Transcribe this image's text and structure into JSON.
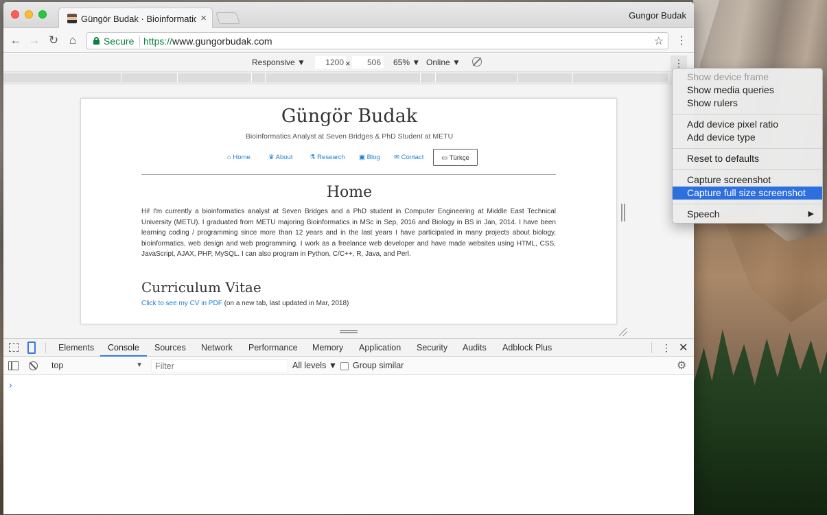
{
  "browser": {
    "tab_title": "Güngör Budak · Bioinformatics",
    "tab_close": "×",
    "profile_name": "Gungor Budak",
    "secure_label": "Secure",
    "url_scheme": "https://",
    "url_host": "www.gungorbudak.com",
    "back": "←",
    "forward": "→",
    "reload": "↻",
    "home": "⌂",
    "bookmark_star": "☆",
    "menu": "⋮"
  },
  "device_toolbar": {
    "device": "Responsive ▼",
    "width": "1200",
    "times": "×",
    "height": "506",
    "zoom": "65% ▼",
    "network": "Online ▼",
    "more": "⋮"
  },
  "site": {
    "title": "Güngör Budak",
    "subtitle": "Bioinformatics Analyst at Seven Bridges & PhD Student at METU",
    "nav": {
      "home": "Home",
      "about": "About",
      "research": "Research",
      "blog": "Blog",
      "contact": "Contact",
      "turkish": "Türkçe"
    },
    "nav_icons": {
      "home": "⌂",
      "about": "♛",
      "research": "⚗",
      "blog": "▣",
      "contact": "✉",
      "turkish": "▭"
    },
    "home_heading": "Home",
    "intro": "Hi! I'm currently a bioinformatics analyst at Seven Bridges and a PhD student in Computer Engineering at Middle East Technical University (METU). I graduated from METU majoring Bioinformatics in MSc in Sep, 2016 and Biology in BS in Jan, 2014. I have been learning coding / programming since more than 12 years and in the last years I have participated in many projects about biology, bioinformatics, web design and web programming. I work as a freelance web developer and have made websites using HTML, CSS, JavaScript, AJAX, PHP, MySQL. I can also program in Python, C/C++, R, Java, and Perl.",
    "cv_heading": "Curriculum Vitae",
    "cv_link": "Click to see my CV in PDF",
    "cv_note": " (on a new tab, last updated in Mar, 2018)"
  },
  "devtools": {
    "tabs": [
      "Elements",
      "Console",
      "Sources",
      "Network",
      "Performance",
      "Memory",
      "Application",
      "Security",
      "Audits",
      "Adblock Plus"
    ],
    "active_tab": "Console",
    "kebab": "⋮",
    "close": "✕",
    "context": "top",
    "context_caret": "▼",
    "filter_placeholder": "Filter",
    "levels": "All levels ▼",
    "group_similar": "Group similar",
    "gear": "⚙",
    "prompt": "›"
  },
  "context_menu": {
    "items": [
      "Show device frame",
      "Show media queries",
      "Show rulers",
      "Add device pixel ratio",
      "Add device type",
      "Reset to defaults",
      "Capture screenshot",
      "Capture full size screenshot",
      "Speech"
    ],
    "disabled_item": "Show device frame",
    "highlighted_item": "Capture full size screenshot",
    "submenu_arrow": "▶"
  },
  "colors": {
    "link": "#1a7fd0",
    "secure_green": "#0b8043",
    "devtools_accent": "#3879d9",
    "menu_highlight": "#2e6fe0"
  }
}
